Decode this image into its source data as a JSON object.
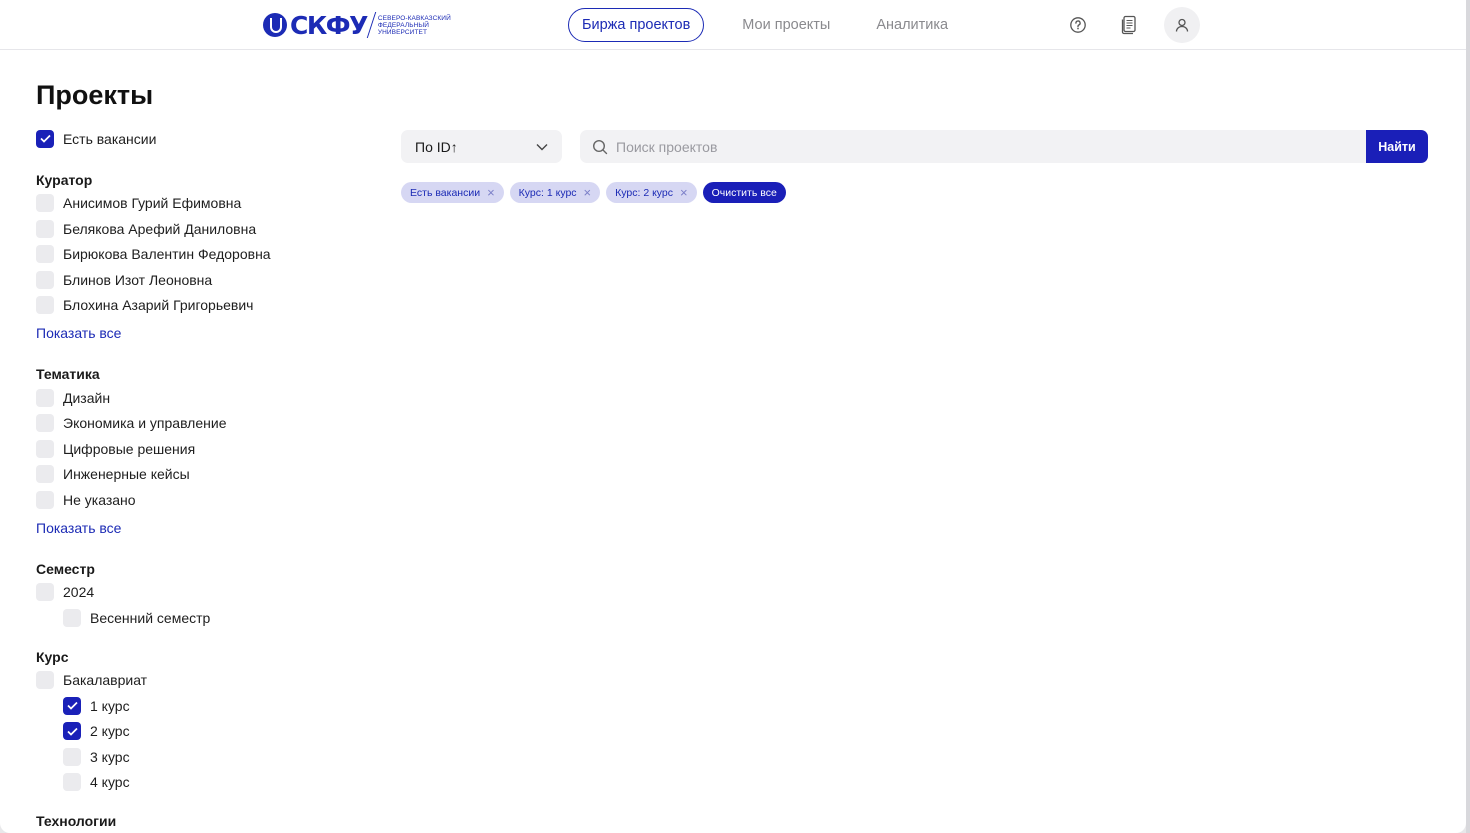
{
  "header": {
    "logo_text": "СКФУ",
    "logo_sub": "Северо-Кавказский федеральный университет",
    "tabs": [
      {
        "label": "Биржа проектов",
        "active": true
      },
      {
        "label": "Мои проекты",
        "active": false
      },
      {
        "label": "Аналитика",
        "active": false
      }
    ],
    "icons": [
      "help-icon",
      "documents-icon",
      "user-icon"
    ]
  },
  "page": {
    "title": "Проекты"
  },
  "filters": {
    "has_vacancies": {
      "label": "Есть вакансии",
      "checked": true
    },
    "curator": {
      "title": "Куратор",
      "items": [
        {
          "label": "Анисимов Гурий Ефимовна",
          "checked": false
        },
        {
          "label": "Белякова Арефий Даниловна",
          "checked": false
        },
        {
          "label": "Бирюкова Валентин Федоровна",
          "checked": false
        },
        {
          "label": "Блинов Изот Леоновна",
          "checked": false
        },
        {
          "label": "Блохина Азарий Григорьевич",
          "checked": false
        }
      ],
      "show_all": "Показать все"
    },
    "topic": {
      "title": "Тематика",
      "items": [
        {
          "label": "Дизайн",
          "checked": false
        },
        {
          "label": "Экономика и управление",
          "checked": false
        },
        {
          "label": "Цифровые решения",
          "checked": false
        },
        {
          "label": "Инженерные кейсы",
          "checked": false
        },
        {
          "label": "Не указано",
          "checked": false
        }
      ],
      "show_all": "Показать все"
    },
    "semester": {
      "title": "Семестр",
      "year": {
        "label": "2024",
        "checked": false
      },
      "sub": {
        "label": "Весенний семестр",
        "checked": false
      }
    },
    "course": {
      "title": "Курс",
      "level": {
        "label": "Бакалавриат",
        "checked": false
      },
      "items": [
        {
          "label": "1 курс",
          "checked": true
        },
        {
          "label": "2 курс",
          "checked": true
        },
        {
          "label": "3 курс",
          "checked": false
        },
        {
          "label": "4 курс",
          "checked": false
        }
      ]
    },
    "technologies": {
      "title": "Технологии"
    }
  },
  "toolbar": {
    "sort_label": "По ID↑",
    "search_placeholder": "Поиск проектов",
    "search_button": "Найти"
  },
  "chips": [
    {
      "label": "Есть вакансии"
    },
    {
      "label": "Курс: 1 курс"
    },
    {
      "label": "Курс: 2 курс"
    }
  ],
  "clear_all": "Очистить все",
  "colors": {
    "accent": "#1a1fb8",
    "chip_bg": "#d6d7f3",
    "checkbox_off": "#ebebee"
  }
}
